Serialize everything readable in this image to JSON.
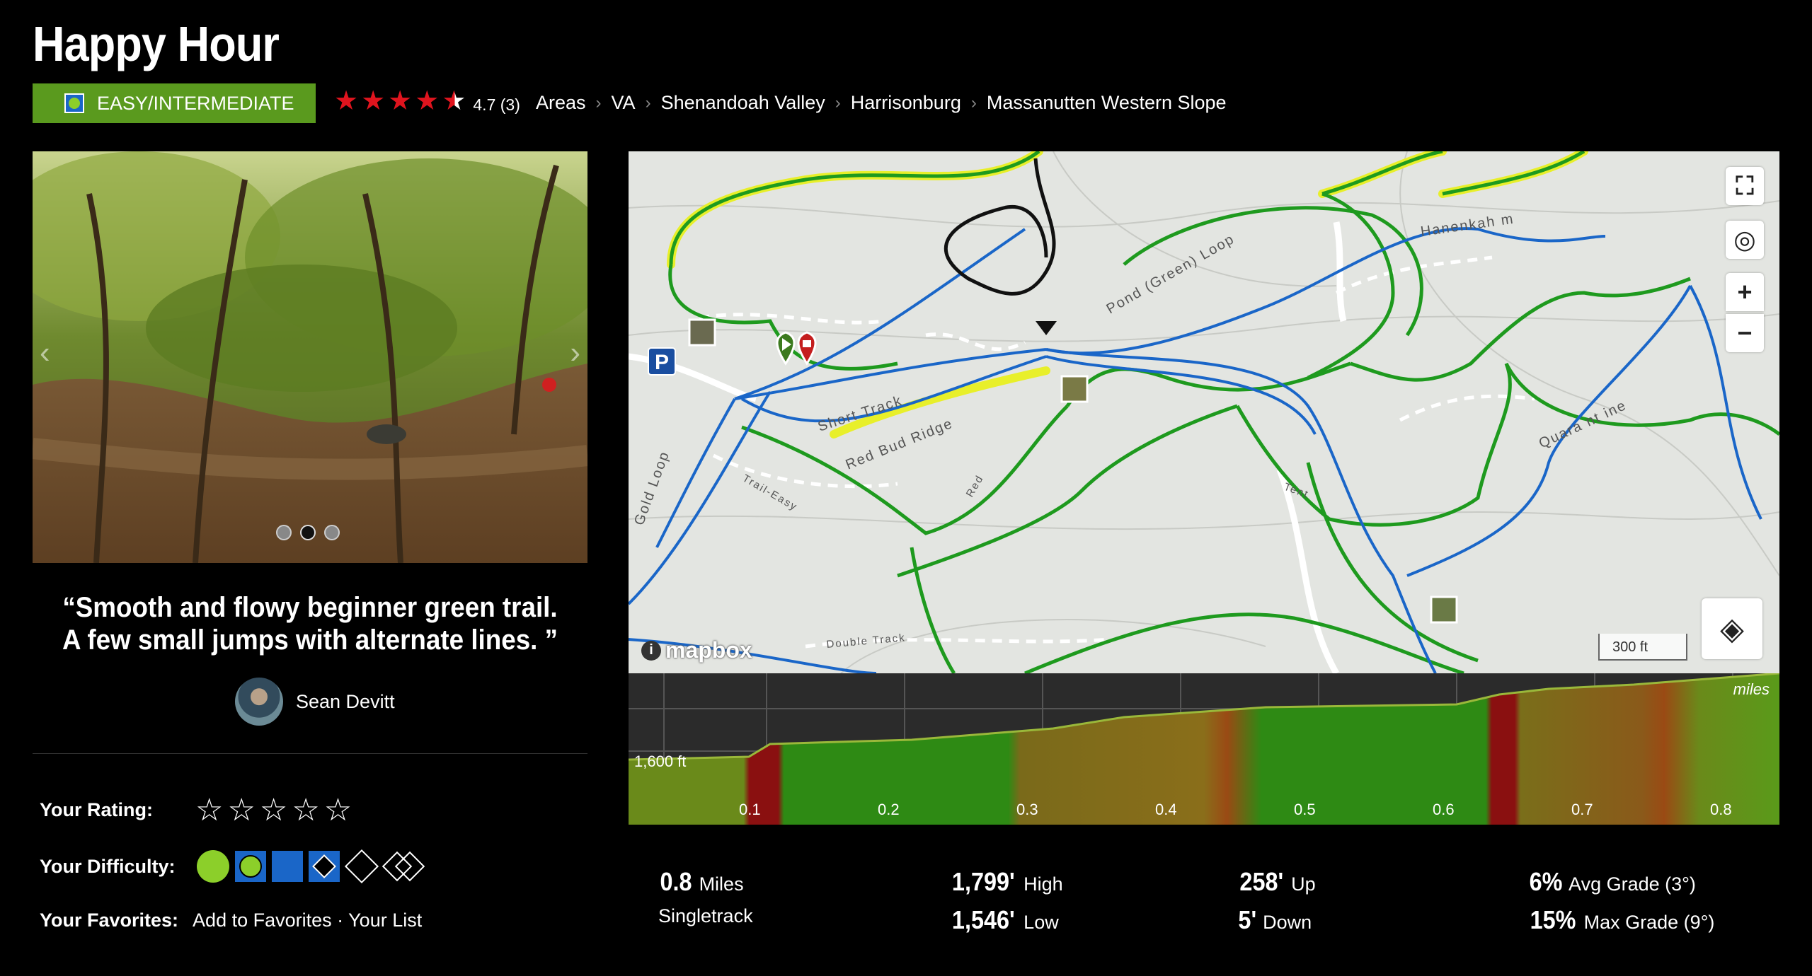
{
  "route": {
    "title": "Happy Hour",
    "difficulty": "EASY/INTERMEDIATE",
    "rating_text": "4.7 (3)",
    "rating_value": 4.7,
    "breadcrumb": [
      "Areas",
      "VA",
      "Shenandoah Valley",
      "Harrisonburg",
      "Massanutten Western Slope"
    ]
  },
  "quote": {
    "text": "“Smooth and flowy beginner green trail. A few small jumps with alternate lines. ”",
    "author": "Sean Devitt"
  },
  "user": {
    "rating_label": "Your Rating:",
    "difficulty_label": "Your Difficulty:",
    "favorites_label": "Your Favorites:",
    "add_favorites": "Add to Favorites",
    "separator": " · ",
    "your_list": "Your List"
  },
  "map": {
    "labels": {
      "pond_loop": "Pond (Green) Loop",
      "hanenkah": "Hanenkah m",
      "short_track": "Short Track",
      "red_bud": "Red Bud Ridge",
      "gold_loop": "Gold Loop",
      "trail_easy": "Trail-Easy",
      "quarantine": "Quara nt ine",
      "double_track": "Double Track",
      "red": "Red",
      "tent": "Tent"
    },
    "logo": "mapbox",
    "scale": "300 ft",
    "parking_glyph": "P",
    "icons": [
      "fullscreen-icon",
      "locate-icon",
      "zoom-in-icon",
      "zoom-out-icon",
      "layers-icon"
    ]
  },
  "profile": {
    "elevation_label": "1,600 ft",
    "unit_label": "miles",
    "ticks": [
      "0.1",
      "0.2",
      "0.3",
      "0.4",
      "0.5",
      "0.6",
      "0.7",
      "0.8"
    ]
  },
  "stats": {
    "distance": {
      "value": "0.8",
      "unit": "Miles"
    },
    "type": "Singletrack",
    "high": {
      "value": "1,799'",
      "label": "High"
    },
    "low": {
      "value": "1,546'",
      "label": "Low"
    },
    "up": {
      "value": "258'",
      "label": "Up"
    },
    "down": {
      "value": "5'",
      "label": "Down"
    },
    "avg_grade": {
      "value": "6%",
      "label": "Avg Grade (3°)"
    },
    "max_grade": {
      "value": "15%",
      "label": "Max Grade (9°)"
    }
  },
  "colors": {
    "badge": "#5a9a1e",
    "star": "#e0141e",
    "trail_green": "#1e9a1e",
    "trail_blue": "#1a66c8",
    "trail_yellow": "#e8ef2a"
  }
}
